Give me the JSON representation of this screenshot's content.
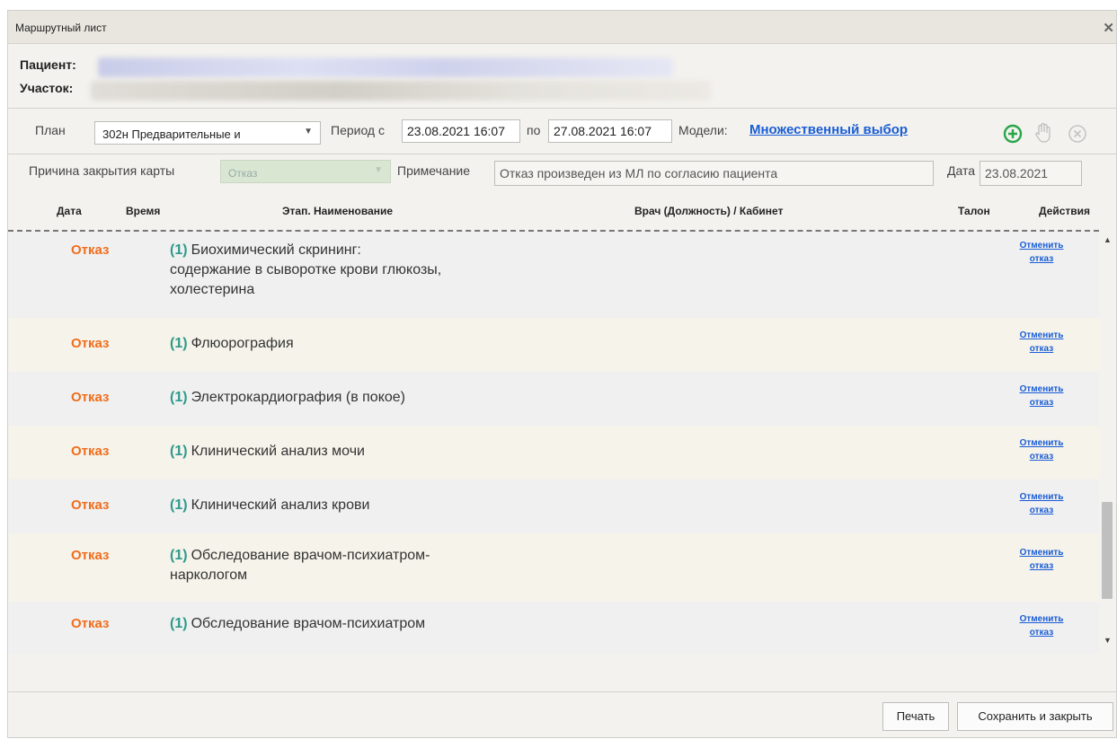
{
  "window": {
    "title": "Маршрутный лист",
    "close_label": "✕"
  },
  "patient_label": "Пациент:",
  "area_label": "Участок:",
  "toolbar": {
    "plan_label": "План",
    "plan_value": "302н Предварительные и",
    "period_label": "Период с",
    "period_from": "23.08.2021 16:07",
    "period_to_label": "по",
    "period_to": "27.08.2021 16:07",
    "models_label": "Модели:",
    "models_link": "Множественный выбор",
    "icons": [
      "add-circle-icon",
      "hand-icon",
      "cancel-circle-icon"
    ]
  },
  "closing": {
    "reason_label": "Причина закрытия карты",
    "reason_value": "Отказ",
    "note_label": "Примечание",
    "note_value": "Отказ произведен из МЛ по согласию пациента",
    "date_label": "Дата",
    "date_value": "23.08.2021"
  },
  "columns": [
    "Дата",
    "Время",
    "Этап. Наименование",
    "Врач (Должность) / Кабинет",
    "Талон",
    "Действия"
  ],
  "rows": [
    {
      "status": "Отказ",
      "num": "(1)",
      "lines": [
        "Биохимический скрининг:",
        "содержание в сыворотке крови глюкозы,",
        "холестерина"
      ],
      "action1": "Отменить",
      "action2": "отказ"
    },
    {
      "status": "Отказ",
      "num": "(1)",
      "lines": [
        "Флюорография"
      ],
      "action1": "Отменить",
      "action2": "отказ"
    },
    {
      "status": "Отказ",
      "num": "(1)",
      "lines": [
        "Электрокардиография (в покое)"
      ],
      "action1": "Отменить",
      "action2": "отказ"
    },
    {
      "status": "Отказ",
      "num": "(1)",
      "lines": [
        "Клинический анализ мочи"
      ],
      "action1": "Отменить",
      "action2": "отказ"
    },
    {
      "status": "Отказ",
      "num": "(1)",
      "lines": [
        "Клинический анализ крови"
      ],
      "action1": "Отменить",
      "action2": "отказ"
    },
    {
      "status": "Отказ",
      "num": "(1)",
      "lines": [
        "Обследование врачом-психиатром-",
        "наркологом"
      ],
      "action1": "Отменить",
      "action2": "отказ"
    },
    {
      "status": "Отказ",
      "num": "(1)",
      "lines": [
        "Обследование врачом-психиатром"
      ],
      "action1": "Отменить",
      "action2": "отказ"
    }
  ],
  "footer": {
    "print_label": "Печать",
    "save_close_label": "Сохранить и закрыть"
  }
}
